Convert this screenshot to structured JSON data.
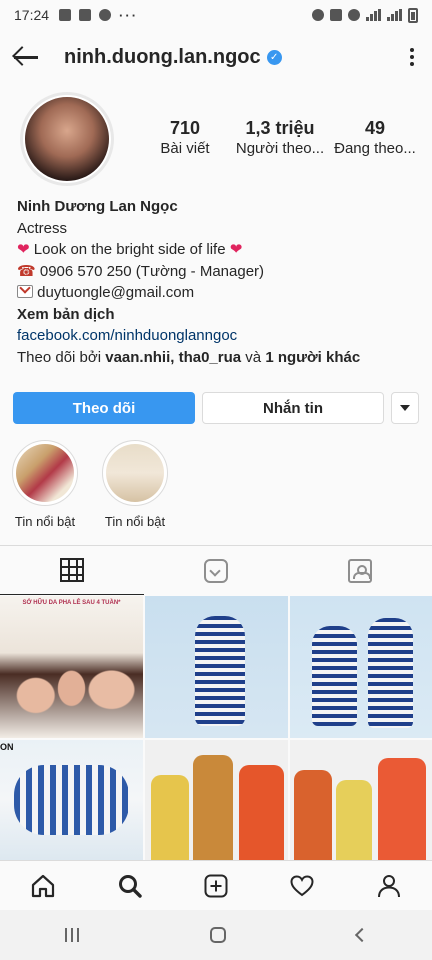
{
  "status_bar": {
    "time": "17:24"
  },
  "header": {
    "username": "ninh.duong.lan.ngoc",
    "verified_mark": "✓"
  },
  "stats": [
    {
      "value": "710",
      "label": "Bài viết"
    },
    {
      "value": "1,3 triệu",
      "label": "Người theo..."
    },
    {
      "value": "49",
      "label": "Đang theo..."
    }
  ],
  "bio": {
    "name": "Ninh Dương Lan Ngọc",
    "category": "Actress",
    "heart": "❤",
    "line1": " Look on the bright side of life ",
    "phone_icon": "☎",
    "phone": " 0906 570 250 (Tường - Manager)",
    "email": " duytuongle@gmail.com",
    "translate": "Xem bản dịch",
    "link": "facebook.com/ninhduonglanngoc",
    "followed_by_prefix": "Theo dõi bởi ",
    "followed_by_names": "vaan.nhii, tha0_rua",
    "followed_by_and": " và ",
    "followed_by_others": "1 người khác"
  },
  "buttons": {
    "follow": "Theo dõi",
    "message": "Nhắn tin"
  },
  "highlights": [
    {
      "label": "Tin nổi bật"
    },
    {
      "label": "Tin nổi bật"
    }
  ],
  "tabs": [
    {
      "icon": "grid-icon",
      "active": true
    },
    {
      "icon": "igtv-icon",
      "active": false
    },
    {
      "icon": "tagged-icon",
      "active": false
    }
  ],
  "posts": {
    "first_caption": "SỞ HỮU DA PHA LÊ SAU 4 TUẦN*",
    "fourth_caption": "ON"
  },
  "colors": {
    "follow_button": "#3897f0",
    "verified": "#3897f0",
    "link": "#003569",
    "heart": "#e0245e"
  }
}
